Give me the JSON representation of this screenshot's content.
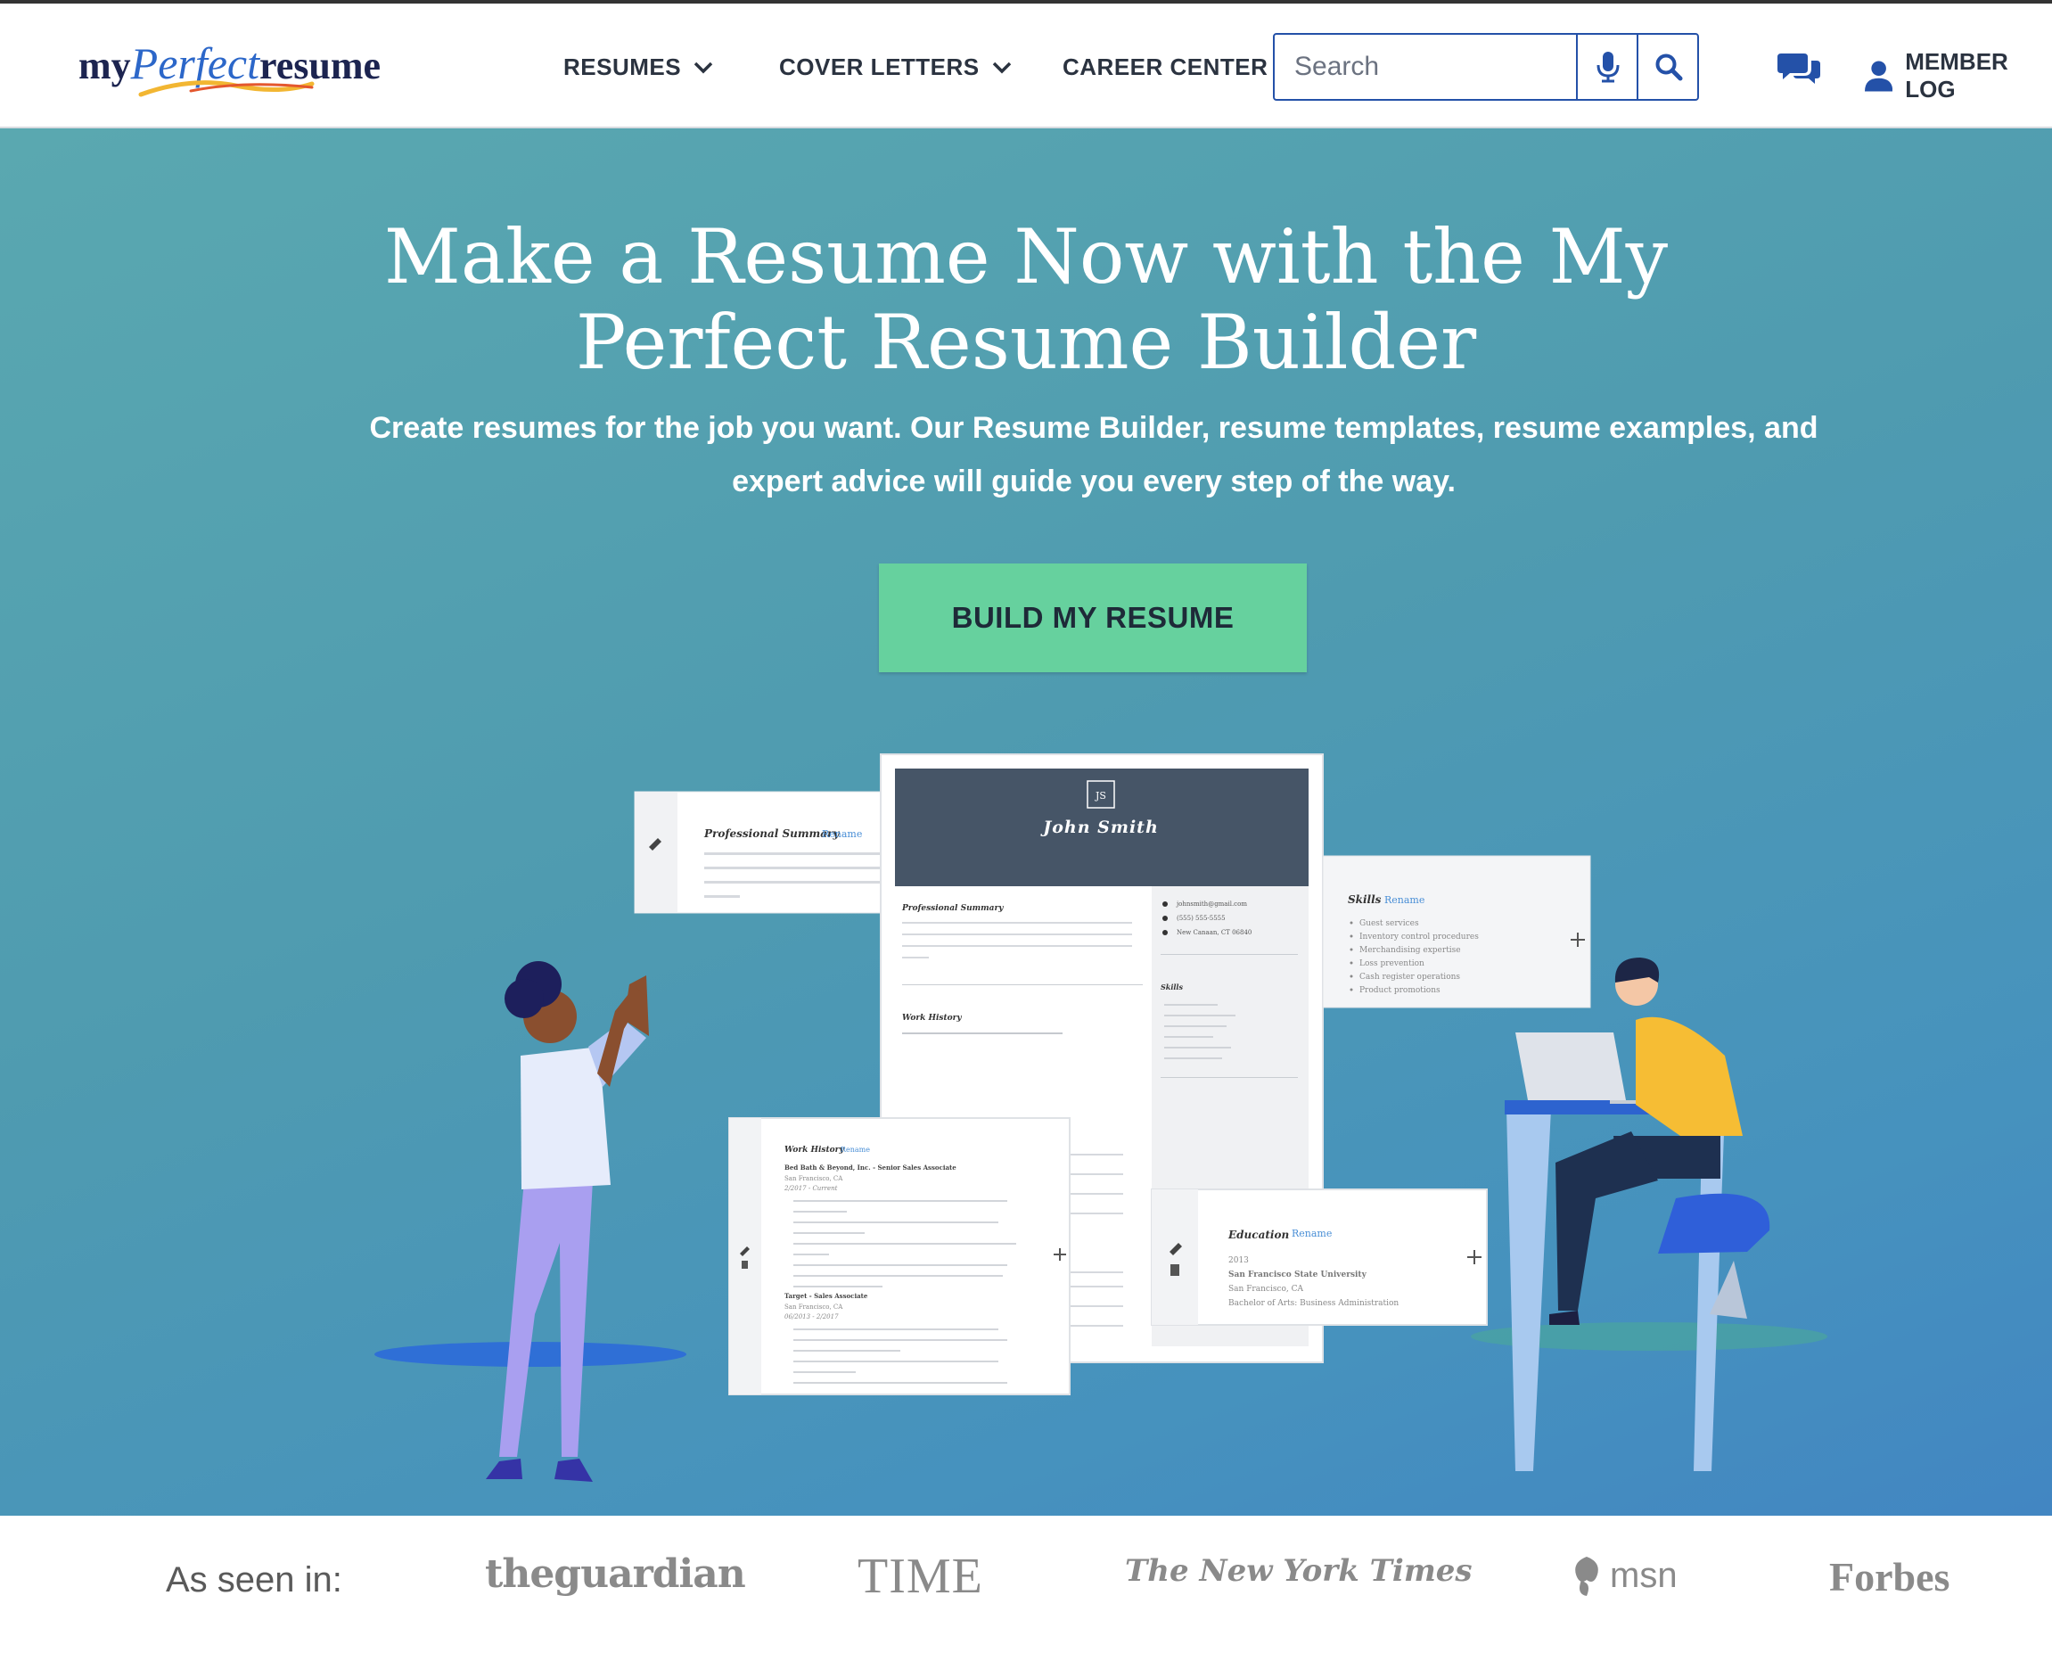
{
  "header": {
    "logo": {
      "my": "my",
      "perfect": "Perfect",
      "resume": "resume"
    },
    "nav": [
      {
        "label": "RESUMES",
        "has_dropdown": true
      },
      {
        "label": "COVER LETTERS",
        "has_dropdown": true
      },
      {
        "label": "CAREER CENTER",
        "has_dropdown": false
      }
    ],
    "search": {
      "placeholder": "Search",
      "mic_icon": "microphone-icon",
      "search_icon": "magnifier-icon"
    },
    "chat_icon": "chat-bubbles-icon",
    "member_login": "MEMBER LOG"
  },
  "hero": {
    "title_line1": "Make a Resume Now with the My",
    "title_line2": "Perfect Resume Builder",
    "subtitle_line1": "Create resumes for the job you want. Our Resume Builder, resume templates, resume examples, and",
    "subtitle_line2": "expert advice will guide you every step of the way.",
    "cta_label": "BUILD MY RESUME"
  },
  "resume_mock": {
    "initials": "JS",
    "name": "John Smith",
    "professional_summary": "Professional Summary",
    "work_history": "Work History",
    "skills": "Skills",
    "education": "Education",
    "rename": "Rename",
    "edu_year": "2013",
    "edu_school": "San Francisco State University",
    "edu_city": "San Francisco, CA",
    "edu_degree": "Bachelor of Arts: Business Administration",
    "job1_title": "Bed Bath & Beyond, Inc. - Senior Sales Associate",
    "job1_city": "San Francisco, CA",
    "job1_dates": "2/2017 - Current",
    "job2_title": "Target - Sales Associate",
    "job2_city": "San Francisco, CA",
    "job2_dates": "06/2013 - 2/2017",
    "email": "johnsmith@gmail.com",
    "phone": "(555) 555-5555",
    "location": "New Canaan, CT 06840",
    "skills_list": [
      "Guest services",
      "Inventory control procedures",
      "Merchandising expertise",
      "Loss prevention",
      "Cash register operations",
      "Product promotions"
    ]
  },
  "as_seen_in": {
    "label": "As seen in:",
    "logos": [
      "theguardian",
      "TIME",
      "The New York Times",
      "msn",
      "Forbes"
    ]
  },
  "colors": {
    "cta": "#66d19e",
    "brand_navy": "#1c2450",
    "brand_blue": "#2c67c9",
    "hero_start": "#5aa8b0",
    "hero_end": "#4286c2"
  }
}
